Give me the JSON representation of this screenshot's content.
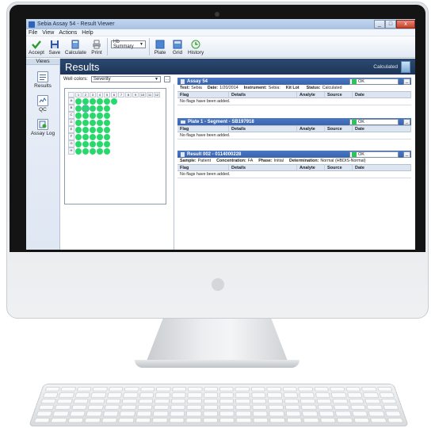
{
  "window": {
    "title": "Sebia Assay 54 - Result Viewer",
    "min": "_",
    "max": "□",
    "close": "x"
  },
  "menu": [
    "File",
    "View",
    "Actions",
    "Help"
  ],
  "toolbar": {
    "accept": "Accept",
    "save": "Save",
    "calculate": "Calculate",
    "print": "Print",
    "summary_select": "Hb Summary",
    "plate": "Plate",
    "grid": "Grid",
    "history": "History"
  },
  "views": {
    "header": "Views",
    "items": [
      "Results",
      "QC",
      "Assay Log"
    ]
  },
  "results": {
    "title": "Results",
    "status": "Calculated"
  },
  "well_colors": {
    "label": "Well colors:",
    "value": "Severity",
    "more": "..."
  },
  "plate": {
    "columns": [
      "1",
      "2",
      "3",
      "4",
      "5",
      "6",
      "7",
      "8",
      "9",
      "10",
      "11",
      "12"
    ],
    "rows": [
      "A",
      "B",
      "C",
      "D",
      "E",
      "F",
      "G",
      "H"
    ]
  },
  "panels": {
    "assay": {
      "title": "Assay 54",
      "status": "OK",
      "fields": [
        {
          "label": "Test:",
          "value": "Sebia"
        },
        {
          "label": "Date:",
          "value": "1/20/2014"
        },
        {
          "label": "Instrument:",
          "value": "Sebia:"
        },
        {
          "label": "Kit Lot",
          "value": ""
        },
        {
          "label": "Status:",
          "value": "Calculated"
        }
      ]
    },
    "plate": {
      "title": "Plate 1 - Segment - SB197918",
      "status": "OK"
    },
    "result": {
      "title": "Result 002 - 0114000228",
      "status": "OK",
      "fields": [
        {
          "label": "Sample:",
          "value": "Patient"
        },
        {
          "label": "Concentration:",
          "value": "FA"
        },
        {
          "label": "Phase:",
          "value": "Initial"
        },
        {
          "label": "Determination:",
          "value": "Normal (HBDIS-Normal)"
        }
      ]
    },
    "columns": [
      "Flag",
      "Details",
      "Analyte",
      "Source",
      "Date"
    ],
    "no_flags": "No flags have been added."
  },
  "colors": {
    "header_bg": "#1d3557",
    "panel_head": "#3a63ad",
    "well_green": "#27d96a",
    "ok_green": "#2fc45a"
  }
}
